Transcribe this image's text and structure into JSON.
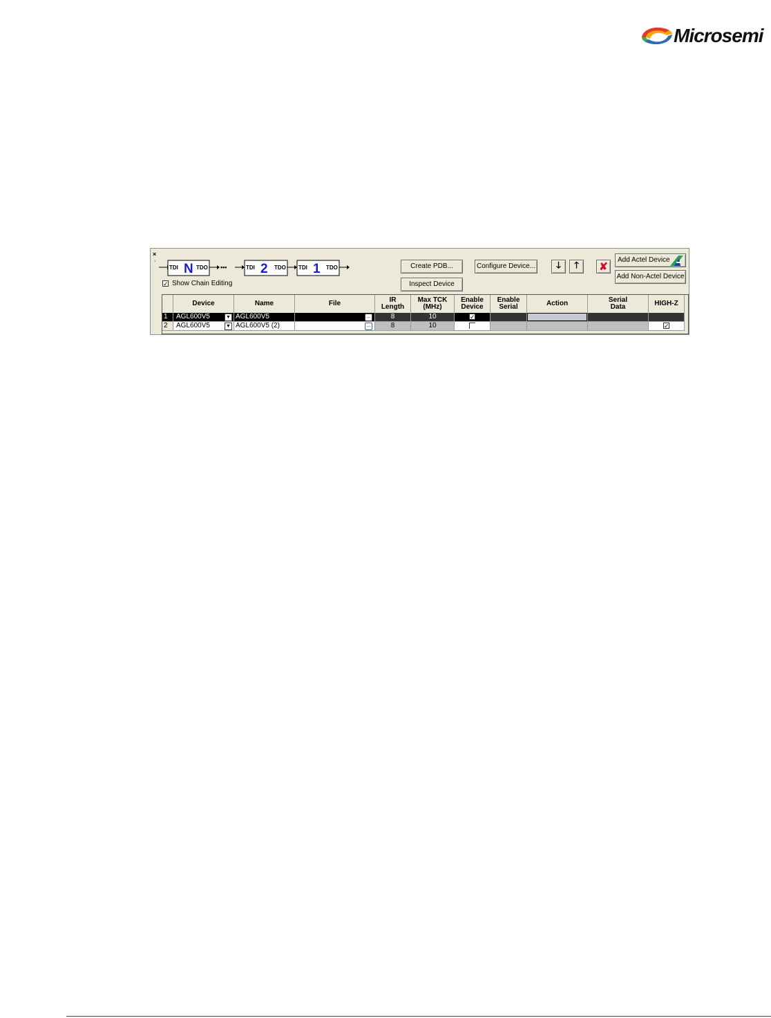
{
  "brand": {
    "name": "Microsemi"
  },
  "panel": {
    "chain_labels": {
      "tdi": "TDI",
      "tdo": "TDO",
      "n": "N",
      "two": "2",
      "one": "1",
      "dots": "•••"
    },
    "show_chain_editing": {
      "label": "Show Chain Editing",
      "checked": true
    },
    "buttons": {
      "create_pdb": "Create PDB...",
      "configure_device": "Configure Device...",
      "inspect_device": "Inspect Device",
      "add_actel_device": "Add Actel Device",
      "add_non_actel_device": "Add Non-Actel Device"
    },
    "table": {
      "headers": {
        "device": "Device",
        "name": "Name",
        "file": "File",
        "ir_length": [
          "IR",
          "Length"
        ],
        "max_tck": [
          "Max TCK",
          "(MHz)"
        ],
        "enable_device": [
          "Enable",
          "Device"
        ],
        "enable_serial": [
          "Enable",
          "Serial"
        ],
        "action": "Action",
        "serial_data": [
          "Serial",
          "Data"
        ],
        "high_z": "HIGH-Z"
      },
      "rows": [
        {
          "index": "1",
          "device": "AGL600V5",
          "name": "AGL600V5",
          "ir_length": "8",
          "max_tck": "10",
          "enable_device": true,
          "high_z": false,
          "selected": true
        },
        {
          "index": "2",
          "device": "AGL600V5",
          "name": "AGL600V5 (2)",
          "ir_length": "8",
          "max_tck": "10",
          "enable_device": false,
          "high_z": true,
          "selected": false
        }
      ]
    }
  }
}
